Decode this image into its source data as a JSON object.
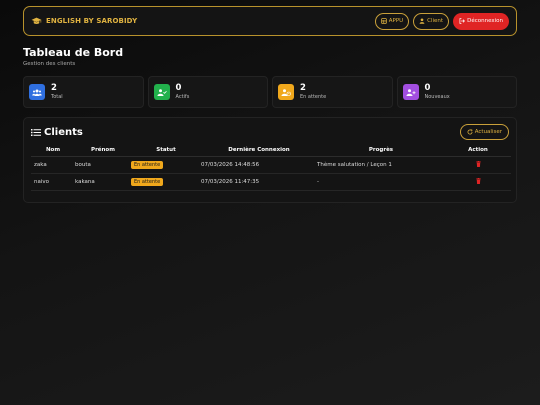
{
  "navbar": {
    "brand": "ENGLISH BY SAROBIDY",
    "appu_label": "APPU",
    "client_label": "Client",
    "logout_label": "Déconnexion"
  },
  "page": {
    "title": "Tableau de Bord",
    "subtitle": "Gestion des clients"
  },
  "stats": [
    {
      "value": "2",
      "label": "Total",
      "color": "#2f6fe0"
    },
    {
      "value": "0",
      "label": "Actifs",
      "color": "#22b14c"
    },
    {
      "value": "2",
      "label": "En attente",
      "color": "#f0a81c"
    },
    {
      "value": "0",
      "label": "Nouveaux",
      "color": "#a24ee0"
    }
  ],
  "clients": {
    "title": "Clients",
    "refresh_label": "Actualiser",
    "columns": [
      "Nom",
      "Prénom",
      "Statut",
      "Dernière Connexion",
      "Progrès",
      "Action"
    ],
    "rows": [
      {
        "nom": "zaka",
        "prenom": "bouta",
        "statut": "En attente",
        "connexion": "07/03/2026 14:48:56",
        "progres": "Thème salutation / Leçon 1"
      },
      {
        "nom": "naivo",
        "prenom": "kakana",
        "statut": "En attente",
        "connexion": "07/03/2026 11:47:35",
        "progres": "-"
      }
    ]
  },
  "colors": {
    "accent": "#e0b341",
    "danger": "#e02424",
    "badge": "#f0a81c"
  }
}
